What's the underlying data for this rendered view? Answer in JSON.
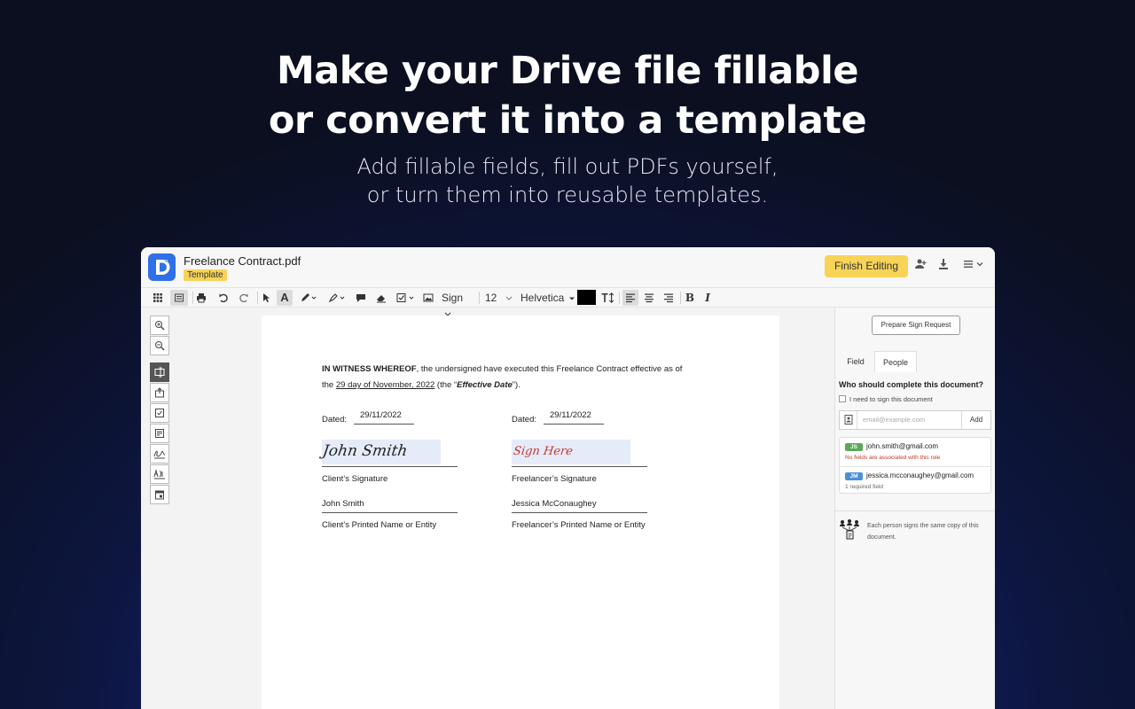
{
  "hero": {
    "title_line1": "Make your Drive file fillable",
    "title_line2": "or convert it into a template",
    "subtitle_line1": "Add fillable fields, fill out PDFs yourself,",
    "subtitle_line2": "or turn them into reusable templates."
  },
  "header": {
    "file_name": "Freelance Contract.pdf",
    "badge": "Template",
    "finish_button": "Finish Editing",
    "icons": [
      "add-person-icon",
      "download-icon",
      "menu-icon"
    ]
  },
  "toolbar": {
    "sign_label": "Sign",
    "font_size": "12",
    "font_family": "Helvetica",
    "text_color": "#000000",
    "bold_label": "B",
    "italic_label": "I"
  },
  "side_tools": [
    "zoom-in-icon",
    "zoom-out-icon",
    "text-field-icon",
    "upload-icon",
    "checkbox-icon",
    "form-icon",
    "signature-icon",
    "initials-icon",
    "date-icon"
  ],
  "document": {
    "witness_bold": "IN WITNESS WHEREOF",
    "witness_rest": ", the undersigned have executed this Freelance Contract effective as of",
    "the_prefix": "the ",
    "effective_date": "29 day of November, 2022",
    "the_middle": " (the “",
    "effective_label": "Effective Date",
    "the_suffix": "”).",
    "dated_label": "Dated:",
    "client_date": "29/11/2022",
    "freelancer_date": "29/11/2022",
    "client_signature_text": "John Smith",
    "freelancer_signature_placeholder": "Sign Here",
    "client_signature_label": "Client’s Signature",
    "freelancer_signature_label": "Freelancer’s Signature",
    "client_name": "John Smith",
    "freelancer_name": "Jessica McConaughey",
    "client_name_label": "Client’s Printed Name or Entity",
    "freelancer_name_label": "Freelancer’s Printed Name or Entity"
  },
  "panel": {
    "prepare_button": "Prepare Sign Request",
    "tabs": [
      "Field",
      "People"
    ],
    "active_tab": "People",
    "question": "Who should complete this document?",
    "self_sign_label": "I need to sign this document",
    "email_placeholder": "email@example.com",
    "add_button": "Add",
    "people": [
      {
        "initials": "JS",
        "email": "john.smith@gmail.com",
        "note": "No fields are associated with this role",
        "badge_color": "#5aa85a",
        "note_color": "#c0392b"
      },
      {
        "initials": "JM",
        "email": "jessica.mcconaughey@gmail.com",
        "note": "1 required field",
        "badge_color": "#4a90d9",
        "note_color": "#666666"
      }
    ],
    "footnote": "Each person signs the same copy of this document."
  }
}
